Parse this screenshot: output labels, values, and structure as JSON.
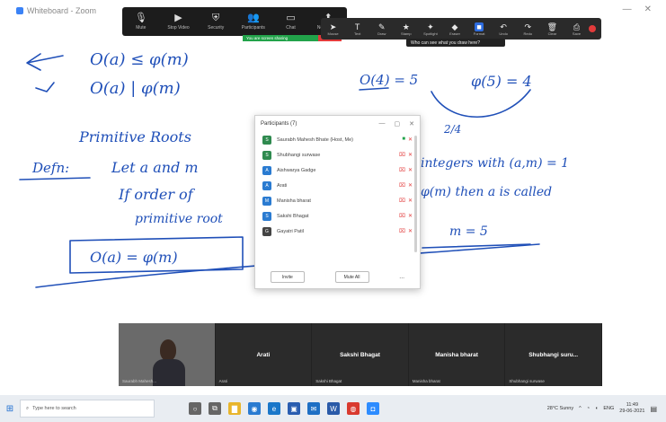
{
  "window": {
    "title": "Whiteboard - Zoom"
  },
  "meeting_toolbar": {
    "items": [
      {
        "icon": "mic-icon",
        "glyph": "🎙",
        "label": "Mute"
      },
      {
        "icon": "video-icon",
        "glyph": "▶",
        "label": "Stop Video"
      },
      {
        "icon": "security-icon",
        "glyph": "⛨",
        "label": "Security"
      },
      {
        "icon": "participants-icon",
        "glyph": "👥",
        "label": "Participants"
      },
      {
        "icon": "chat-icon",
        "glyph": "▭",
        "label": "Chat"
      },
      {
        "icon": "share-icon",
        "glyph": "⬆",
        "label": "New Share"
      }
    ],
    "share_banner": "You are screen sharing",
    "stop_label": "Stop Share"
  },
  "annotation_toolbar": {
    "items": [
      {
        "icon": "mouse-icon",
        "glyph": "➤",
        "label": "Mouse",
        "selected": false
      },
      {
        "icon": "text-icon",
        "glyph": "T",
        "label": "Text",
        "selected": false
      },
      {
        "icon": "draw-icon",
        "glyph": "✎",
        "label": "Draw",
        "selected": false
      },
      {
        "icon": "stamp-icon",
        "glyph": "★",
        "label": "Stamp",
        "selected": false
      },
      {
        "icon": "spotlight-icon",
        "glyph": "✦",
        "label": "Spotlight",
        "selected": false
      },
      {
        "icon": "eraser-icon",
        "glyph": "◆",
        "label": "Eraser",
        "selected": false
      },
      {
        "icon": "format-icon",
        "glyph": "■",
        "label": "Format",
        "selected": true
      },
      {
        "icon": "undo-icon",
        "glyph": "↶",
        "label": "Undo",
        "selected": false
      },
      {
        "icon": "redo-icon",
        "glyph": "↷",
        "label": "Redo",
        "selected": false
      },
      {
        "icon": "clear-icon",
        "glyph": "🗑",
        "label": "Clear",
        "selected": false
      },
      {
        "icon": "save-icon",
        "glyph": "⎙",
        "label": "Save",
        "selected": false
      }
    ],
    "tooltip": "Who can see what you draw here?"
  },
  "board": {
    "texts": [
      "O(a) ≤ φ(m)",
      "O(a) | φ(m)",
      "Primitive Roots",
      "Defn:",
      "Let a and m",
      "integers with (a,m) = 1",
      "If order of",
      "φ(m) then a is called",
      "primitive root",
      "O(a) = φ(m)",
      "O(4) = 5",
      "φ(5) = 4",
      "2/4",
      "m = 5"
    ]
  },
  "participants": {
    "title": "Participants (7)",
    "rows": [
      {
        "initial": "S",
        "color": "#2f8a4f",
        "name": "Saurabh Mahesh Bhate (Host, Me)"
      },
      {
        "initial": "S",
        "color": "#2f8a4f",
        "name": "Shubhangi surwase"
      },
      {
        "initial": "A",
        "color": "#2a7bd1",
        "name": "Aishwarya Gadge"
      },
      {
        "initial": "A",
        "color": "#2a7bd1",
        "name": "Arati"
      },
      {
        "initial": "M",
        "color": "#2a7bd1",
        "name": "Manisha bharat"
      },
      {
        "initial": "S",
        "color": "#2a7bd1",
        "name": "Sakshi Bhagat"
      },
      {
        "initial": "G",
        "color": "#444444",
        "name": "Gayatri Patil"
      }
    ],
    "invite_label": "Invite",
    "mute_all_label": "Mute All",
    "more_label": "..."
  },
  "video_strip": {
    "tiles": [
      {
        "name": "",
        "caption": "Saurabh Mahesh..."
      },
      {
        "name": "Arati",
        "caption": "Arati"
      },
      {
        "name": "Sakshi Bhagat",
        "caption": "Sakshi Bhagat"
      },
      {
        "name": "Manisha bharat",
        "caption": "Manisha bharat"
      },
      {
        "name": "Shubhangi suru...",
        "caption": "Shubhangi surwase"
      }
    ]
  },
  "taskbar": {
    "search_placeholder": "Type here to search",
    "apps": [
      {
        "icon": "search-app-icon",
        "glyph": "○",
        "color": "#666666"
      },
      {
        "icon": "task-view-icon",
        "glyph": "⧉",
        "color": "#666666"
      },
      {
        "icon": "file-explorer-icon",
        "glyph": "▇",
        "color": "#e8b52c"
      },
      {
        "icon": "chrome-icon",
        "glyph": "◉",
        "color": "#2a7bd1"
      },
      {
        "icon": "edge-icon",
        "glyph": "e",
        "color": "#1b77c9"
      },
      {
        "icon": "store-icon",
        "glyph": "▣",
        "color": "#2a5db0"
      },
      {
        "icon": "mail-icon",
        "glyph": "✉",
        "color": "#1e6fc4"
      },
      {
        "icon": "word-icon",
        "glyph": "W",
        "color": "#2a5aa8"
      },
      {
        "icon": "red-app-icon",
        "glyph": "◍",
        "color": "#d93a2f"
      },
      {
        "icon": "zoom-icon",
        "glyph": "◘",
        "color": "#2d8cff"
      }
    ],
    "weather": "28°C Sunny",
    "language": "ENG",
    "time": "11:49",
    "date": "29-06-2021"
  }
}
